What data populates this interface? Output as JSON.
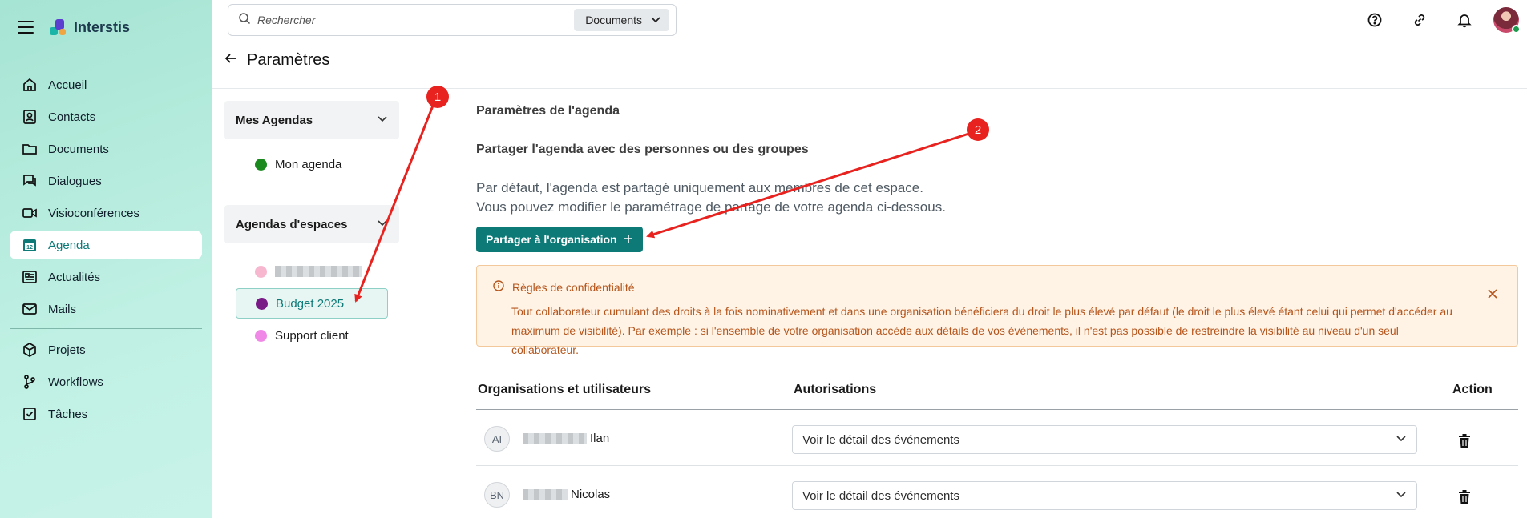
{
  "app": {
    "name": "Interstis"
  },
  "nav": {
    "items": [
      {
        "label": "Accueil",
        "icon": "home-icon"
      },
      {
        "label": "Contacts",
        "icon": "contacts-icon"
      },
      {
        "label": "Documents",
        "icon": "folder-icon"
      },
      {
        "label": "Dialogues",
        "icon": "chat-icon"
      },
      {
        "label": "Visioconférences",
        "icon": "video-icon"
      },
      {
        "label": "Agenda",
        "icon": "calendar-icon",
        "active": true
      },
      {
        "label": "Actualités",
        "icon": "news-icon"
      },
      {
        "label": "Mails",
        "icon": "mail-icon"
      },
      {
        "label": "Projets",
        "icon": "cube-icon"
      },
      {
        "label": "Workflows",
        "icon": "workflow-icon"
      },
      {
        "label": "Tâches",
        "icon": "task-icon"
      }
    ]
  },
  "search": {
    "placeholder": "Rechercher",
    "scope": "Documents"
  },
  "page": {
    "title": "Paramètres"
  },
  "calendars": {
    "mine": {
      "label": "Mes Agendas",
      "items": [
        {
          "label": "Mon agenda",
          "color": "#1a8a1f"
        }
      ]
    },
    "spaces": {
      "label": "Agendas d'espaces",
      "items": [
        {
          "label": "",
          "color": "#f7b8cf",
          "blurred": true
        },
        {
          "label": "Budget 2025",
          "color": "#7a1a86",
          "active": true
        },
        {
          "label": "Support client",
          "color": "#ef88e6"
        }
      ]
    }
  },
  "settings": {
    "heading": "Paramètres de l'agenda",
    "share_heading": "Partager l'agenda avec des personnes ou des groupes",
    "desc_line1": "Par défaut, l'agenda est partagé uniquement aux membres de cet espace.",
    "desc_line2": "Vous pouvez modifier le paramétrage de partage de votre agenda ci-dessous.",
    "share_button": "Partager à l'organisation"
  },
  "alert": {
    "title": "Règles de confidentialité",
    "body": "Tout collaborateur cumulant des droits à la fois nominativement et dans une organisation bénéficiera du droit le plus élevé par défaut (le droit le plus élevé étant celui qui permet d'accéder au maximum de visibilité). Par exemple : si l'ensemble de votre organisation accède aux détails de vos évènements, il n'est pas possible de restreindre la visibilité au niveau d'un seul collaborateur."
  },
  "table": {
    "headers": {
      "org": "Organisations et utilisateurs",
      "auth": "Autorisations",
      "action": "Action"
    },
    "rows": [
      {
        "initials": "AI",
        "name": "Ilan",
        "permission": "Voir le détail des événements"
      },
      {
        "initials": "BN",
        "name": "Nicolas",
        "permission": "Voir le détail des événements"
      }
    ]
  },
  "annotations": {
    "marker1": "1",
    "marker2": "2",
    "color": "#e8231f"
  },
  "colors": {
    "accent": "#0e7a78",
    "alert_bg": "#fff3e6",
    "alert_text": "#b5551b"
  }
}
